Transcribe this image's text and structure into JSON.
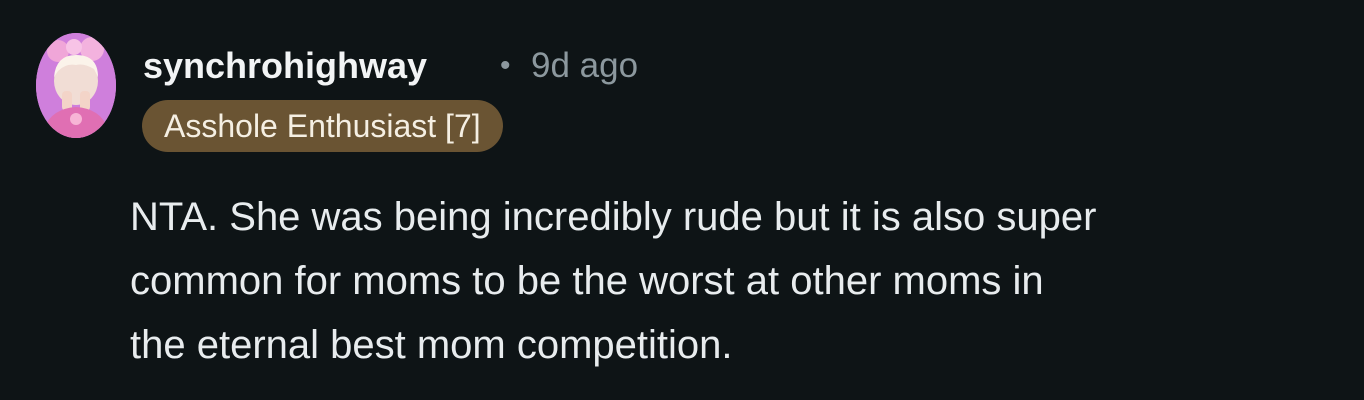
{
  "comment": {
    "author": {
      "username": "synchrohighway",
      "avatar_icon": "user-avatar-icon",
      "flair": "Asshole Enthusiast [7]",
      "flair_color": "#6a5433"
    },
    "separator": "•",
    "timestamp": "9d ago",
    "body_lines": [
      "NTA. She was being incredibly rude but it is also super",
      "common for moms to be the worst at other moms in",
      "the eternal best mom competition."
    ]
  },
  "colors": {
    "background": "#0e1416",
    "username": "#f2f4f5",
    "meta": "#8c989e",
    "body": "#e8ecee"
  }
}
